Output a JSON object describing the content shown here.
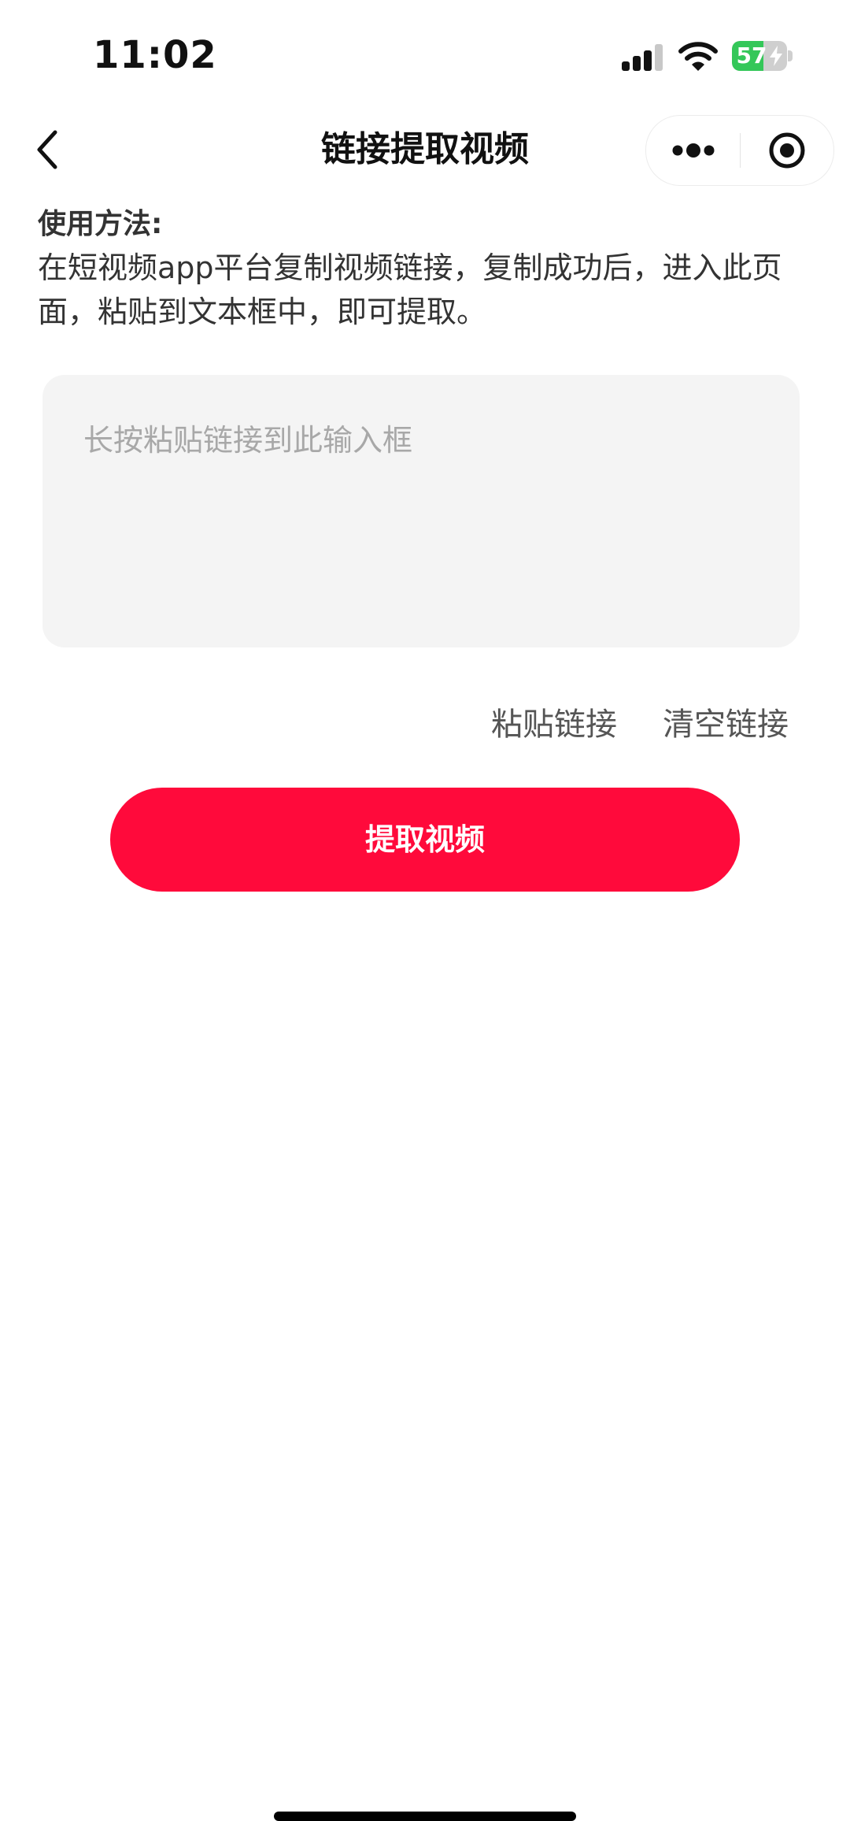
{
  "status_bar": {
    "time": "11:02",
    "battery_level": "57",
    "battery_fraction": 0.57,
    "battery_charging": true,
    "icons": [
      "signal-icon",
      "wifi-icon",
      "battery-icon"
    ]
  },
  "nav": {
    "title": "链接提取视频",
    "back_icon": "chevron-left-icon",
    "more_icon": "more-dots-icon",
    "close_icon": "target-close-icon"
  },
  "usage": {
    "title": "使用方法:",
    "description": "在短视频app平台复制视频链接，复制成功后，进入此页面，粘贴到文本框中，即可提取。"
  },
  "link_input": {
    "value": "",
    "placeholder": "长按粘贴链接到此输入框"
  },
  "actions": {
    "paste_label": "粘贴链接",
    "clear_label": "清空链接"
  },
  "primary_button": {
    "label": "提取视频"
  },
  "colors": {
    "accent": "#ff0a3b",
    "input_bg": "#f4f4f4",
    "battery_green": "#34c759"
  }
}
